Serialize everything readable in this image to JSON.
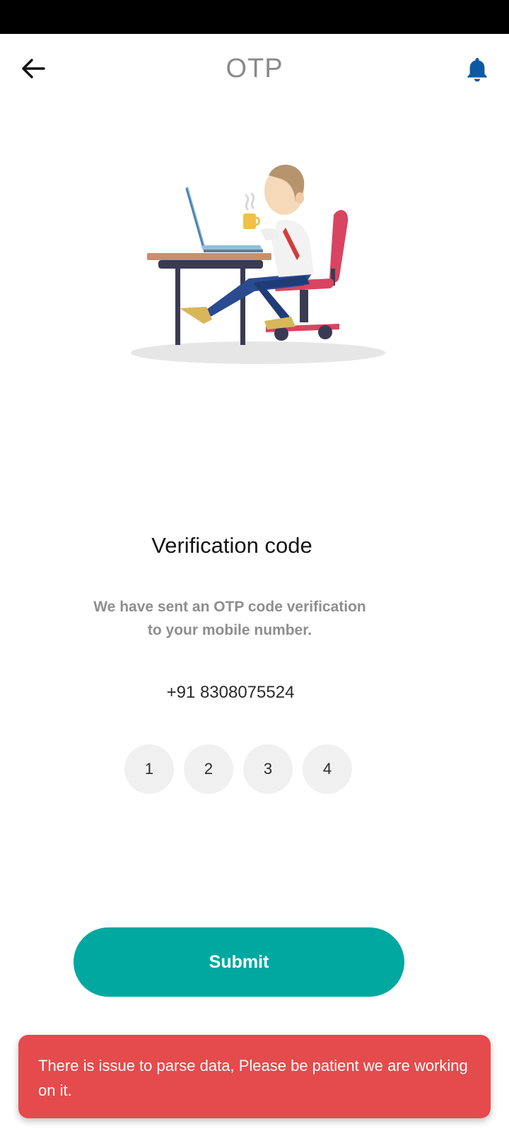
{
  "app_bar": {
    "title": "OTP",
    "back_icon": "arrow-left-icon",
    "notification_icon": "bell-icon",
    "accent_color": "#0a5aa6"
  },
  "illustration": {
    "description_icon": "person-at-desk-illustration"
  },
  "main": {
    "heading": "Verification code",
    "subtext_line1": "We have sent an OTP code verification",
    "subtext_line2": "to your mobile number.",
    "phone_number": "+91 8308075524",
    "otp_digits": [
      "1",
      "2",
      "3",
      "4"
    ]
  },
  "submit": {
    "label": "Submit",
    "color": "#00a8a0"
  },
  "toast": {
    "message": "There is issue to parse data, Please be patient we are working on it.",
    "color": "#e54a4c"
  }
}
